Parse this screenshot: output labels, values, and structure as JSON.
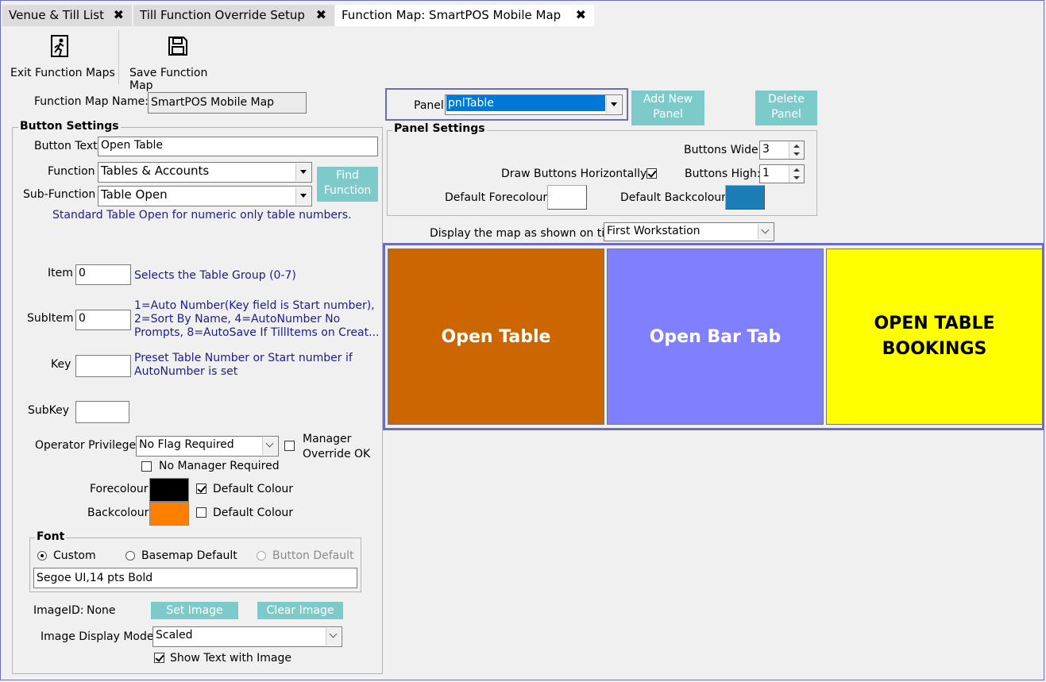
{
  "tabs": [
    {
      "label": "Venue & Till List",
      "close": "✖",
      "active": false
    },
    {
      "label": "Till Function Override Setup",
      "close": "✖",
      "active": false
    },
    {
      "label": "Function Map: SmartPOS Mobile Map",
      "close": "✖",
      "active": true
    }
  ],
  "toolbar": {
    "exit_label": "Exit Function Maps",
    "save_label": "Save Function Map"
  },
  "function_map_name": {
    "label": "Function Map Name:",
    "value": "SmartPOS Mobile Map"
  },
  "button_settings": {
    "title": "Button Settings",
    "button_text_label": "Button Text",
    "button_text_value": "Open Table",
    "function_label": "Function",
    "function_value": "Tables & Accounts",
    "subfunction_label": "Sub-Function",
    "subfunction_value": "Table Open",
    "find_function_line1": "Find",
    "find_function_line2": "Function",
    "description": "Standard Table Open for numeric only table numbers.",
    "item_label": "Item",
    "item_value": "0",
    "item_help": "Selects the Table Group (0-7)",
    "subitem_label": "SubItem",
    "subitem_value": "0",
    "subitem_help_1": "1=Auto Number(Key field is Start number),",
    "subitem_help_2": "2=Sort By Name, 4=AutoNumber No",
    "subitem_help_3": "Prompts, 8=AutoSave If TillItems on Creat...",
    "key_label": "Key",
    "key_value": "",
    "key_help_1": "Preset Table Number or Start number if",
    "key_help_2": "AutoNumber is set",
    "subkey_label": "SubKey",
    "subkey_value": "",
    "operator_privilege_label": "Operator Privilege:",
    "operator_privilege_value": "No Flag Required",
    "manager_override_line1": "Manager",
    "manager_override_line2": "Override OK",
    "manager_override_checked": false,
    "no_manager_required_label": "No Manager Required",
    "no_manager_required_checked": false,
    "forecolour_label": "Forecolour",
    "forecolour": "#000000",
    "fore_default_label": "Default Colour",
    "fore_default_checked": true,
    "backcolour_label": "Backcolour",
    "backcolour": "#ff7f00",
    "back_default_label": "Default Colour",
    "back_default_checked": false
  },
  "font_group": {
    "title": "Font",
    "custom_label": "Custom",
    "basemap_label": "Basemap Default",
    "button_default_label": "Button Default",
    "selected": "custom",
    "font_value": "Segoe UI,14 pts Bold"
  },
  "image": {
    "id_label": "ImageID:",
    "id_value": "None",
    "set_label": "Set Image",
    "clear_label": "Clear Image",
    "display_mode_label": "Image Display Mode:",
    "display_mode_value": "Scaled",
    "show_text_label": "Show Text with Image",
    "show_text_checked": true
  },
  "panel": {
    "label": "Panel",
    "value": "pnlTable",
    "add_line1": "Add New",
    "add_line2": "Panel",
    "delete_line1": "Delete",
    "delete_line2": "Panel"
  },
  "panel_settings": {
    "title": "Panel Settings",
    "buttons_wide_label": "Buttons Wide:",
    "buttons_wide_value": "3",
    "draw_horizontal_label": "Draw Buttons Horizontally:",
    "draw_horizontal_checked": true,
    "buttons_high_label": "Buttons High:",
    "buttons_high_value": "1",
    "default_fore_label": "Default Forecolour",
    "default_fore": "#ffffff",
    "default_back_label": "Default Backcolour",
    "default_back": "#1a7db5"
  },
  "display_map": {
    "label": "Display the map as shown on till:",
    "value": "First Workstation"
  },
  "map_buttons": [
    {
      "line1": "Open Table",
      "line2": "",
      "bg": "#cc6600",
      "fg": "#ffffff"
    },
    {
      "line1": "Open Bar Tab",
      "line2": "",
      "bg": "#8080ff",
      "fg": "#ffffff"
    },
    {
      "line1": "OPEN TABLE",
      "line2": "BOOKINGS",
      "bg": "#ffff00",
      "fg": "#000000"
    }
  ]
}
